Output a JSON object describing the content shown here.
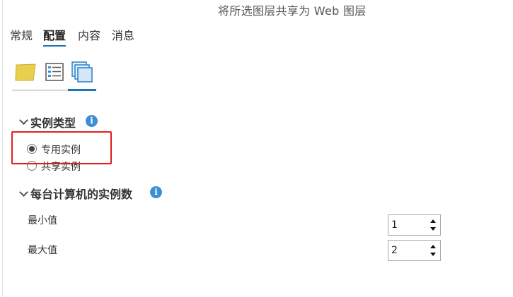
{
  "header": {
    "title": "将所选图层共享为 Web 图层"
  },
  "tabs": [
    {
      "label": "常规",
      "active": false
    },
    {
      "label": "配置",
      "active": true
    },
    {
      "label": "内容",
      "active": false
    },
    {
      "label": "消息",
      "active": false
    }
  ],
  "icon_tabs": [
    {
      "icon": "layer-folder-icon",
      "active": false
    },
    {
      "icon": "layer-properties-icon",
      "active": false
    },
    {
      "icon": "pooling-instances-icon",
      "active": true
    }
  ],
  "instance_type": {
    "heading": "实例类型",
    "options": [
      {
        "label": "专用实例",
        "selected": true
      },
      {
        "label": "共享实例",
        "selected": false
      }
    ]
  },
  "instances_per_machine": {
    "heading": "每台计算机的实例数",
    "min_label": "最小值",
    "min_value": "1",
    "max_label": "最大值",
    "max_value": "2"
  },
  "colors": {
    "accent": "#1b76b8",
    "highlight": "#e02020",
    "info": "#3d8fd4"
  }
}
